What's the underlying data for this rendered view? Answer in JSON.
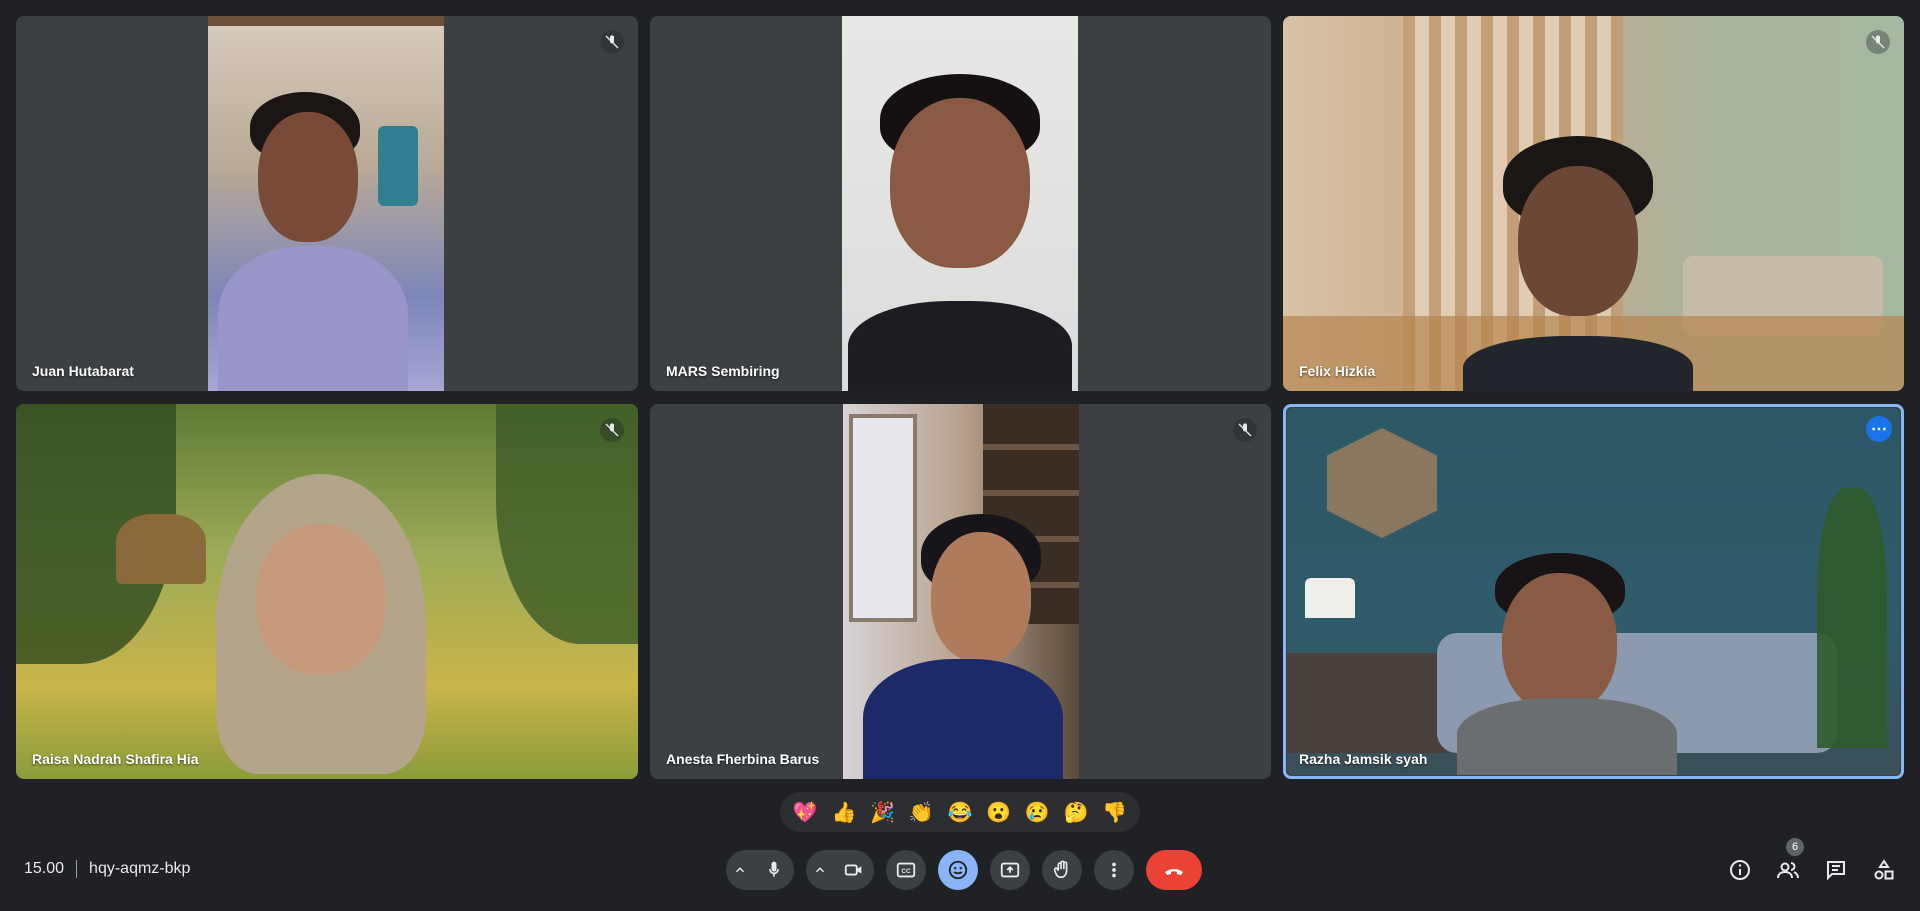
{
  "participants": [
    {
      "name": "Juan Hutabarat",
      "muted": true
    },
    {
      "name": "MARS Sembiring",
      "muted": false
    },
    {
      "name": "Felix Hizkia",
      "muted": true
    },
    {
      "name": "Raisa Nadrah Shafira Hia",
      "muted": true
    },
    {
      "name": "Anesta Fherbina Barus",
      "muted": true
    },
    {
      "name": "Razha Jamsik syah",
      "muted": false,
      "active": true
    }
  ],
  "reactions": [
    "💖",
    "👍",
    "🎉",
    "👏",
    "😂",
    "😮",
    "😢",
    "🤔",
    "👎"
  ],
  "meeting": {
    "time": "15.00",
    "code": "hqy-aqmz-bkp"
  },
  "people_count": "6",
  "icons": {
    "mute": "mic-off-icon",
    "more": "more-options-icon",
    "mic": "mic-icon",
    "camera": "camera-icon",
    "captions": "captions-icon",
    "emoji": "emoji-icon",
    "present": "present-screen-icon",
    "hand": "raise-hand-icon",
    "menu": "more-vert-icon",
    "end": "end-call-icon",
    "info": "info-icon",
    "people": "people-icon",
    "chat": "chat-icon",
    "activities": "activities-icon"
  },
  "colors": {
    "background": "#202124",
    "tile": "#3c4043",
    "active_border": "#8ab4f8",
    "end_call": "#ea4335",
    "emoji_active": "#8ab4f8"
  }
}
